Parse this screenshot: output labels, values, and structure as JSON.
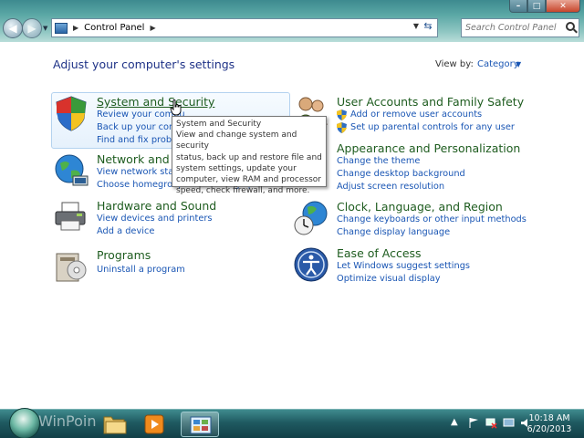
{
  "window": {
    "address": {
      "location": "Control Panel"
    },
    "search": {
      "placeholder": "Search Control Panel"
    }
  },
  "content": {
    "heading": "Adjust your computer's settings",
    "view_by": {
      "label": "View by:",
      "value": "Category"
    }
  },
  "categories": [
    {
      "title": "System and Security",
      "links": [
        "Review your computer's status",
        "Back up your computer",
        "Find and fix problems"
      ],
      "shown_links": [
        "Review your compu",
        "Back up your comp",
        "Find and fix proble"
      ]
    },
    {
      "title": "Network and Internet",
      "shown_title": "Network and In",
      "shown_links": [
        "View network status",
        "Choose homegroup and sharing options"
      ]
    },
    {
      "title": "Hardware and Sound",
      "links": [
        "View devices and printers",
        "Add a device"
      ]
    },
    {
      "title": "Programs",
      "links": [
        "Uninstall a program"
      ]
    },
    {
      "title": "User Accounts and Family Safety",
      "links": [
        "Add or remove user accounts",
        "Set up parental controls for any user"
      ]
    },
    {
      "title": "Appearance and Personalization",
      "links": [
        "Change the theme",
        "Change desktop background",
        "Adjust screen resolution"
      ]
    },
    {
      "title": "Clock, Language, and Region",
      "links": [
        "Change keyboards or other input methods",
        "Change display language"
      ]
    },
    {
      "title": "Ease of Access",
      "links": [
        "Let Windows suggest settings",
        "Optimize visual display"
      ]
    }
  ],
  "tooltip": {
    "title": "System and Security",
    "lines": [
      "View and change system and security",
      "status, back up and restore file and",
      "system settings, update your",
      "computer, view RAM and processor",
      "speed, check firewall, and more."
    ]
  },
  "taskbar": {
    "watermark": "WinPoin",
    "clock": {
      "time": "10:18 AM",
      "date": "6/20/2013"
    }
  },
  "colors": {
    "heading": "#1e3287",
    "category_title": "#1e5c1f",
    "link": "#1a56b4"
  }
}
